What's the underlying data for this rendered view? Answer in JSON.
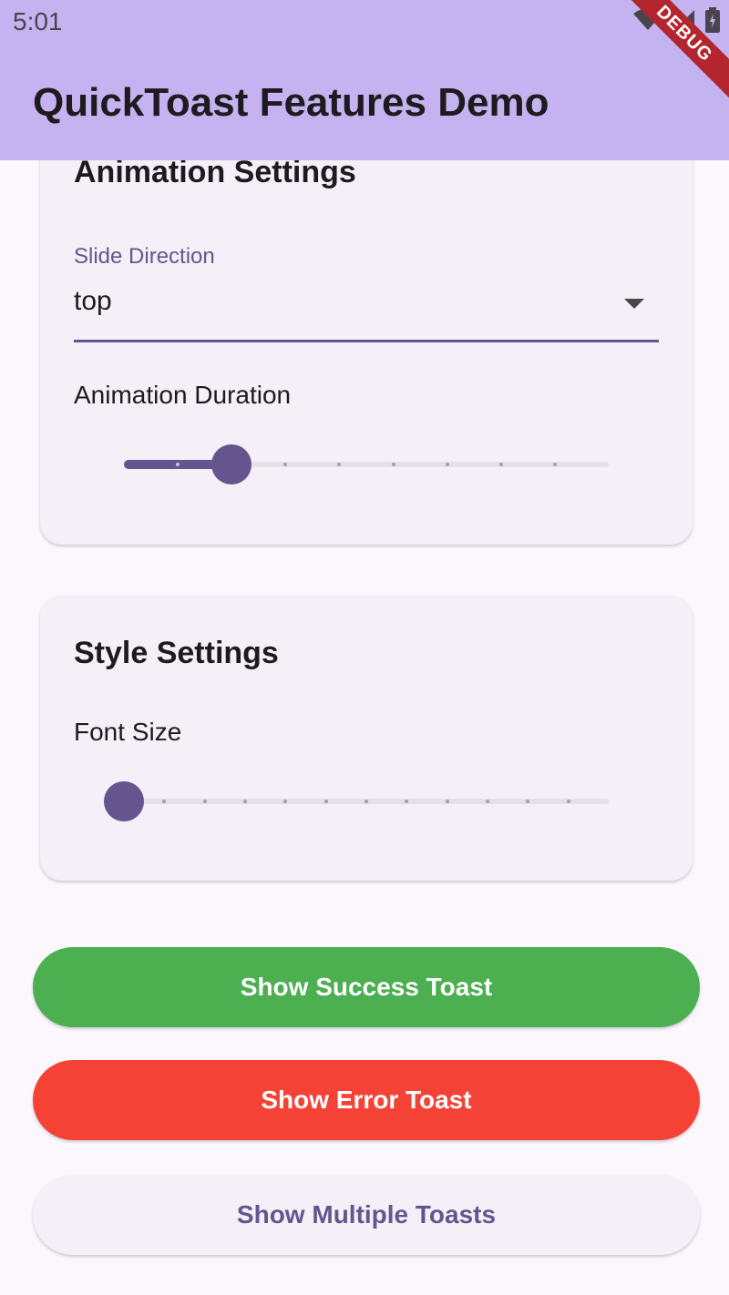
{
  "status_bar": {
    "time": "5:01",
    "icons": [
      "wifi-icon",
      "cell-signal-icon",
      "battery-icon"
    ]
  },
  "app_bar": {
    "title": "QuickToast Features Demo",
    "debug_banner": "DEBUG",
    "color": "#c5b3f1"
  },
  "animation_card": {
    "title": "Animation Settings",
    "slide_direction": {
      "label": "Slide Direction",
      "value": "top"
    },
    "duration_slider": {
      "label": "Animation Duration",
      "divisions": 9,
      "value_fraction": 0.2222
    }
  },
  "style_card": {
    "title": "Style Settings",
    "font_size_slider": {
      "label": "Font Size",
      "divisions": 12,
      "value_fraction": 0
    }
  },
  "buttons": {
    "success": "Show Success Toast",
    "error": "Show Error Toast",
    "multiple": "Show Multiple Toasts"
  },
  "colors": {
    "primary": "#65558f",
    "success": "#4caf50",
    "error": "#f44336",
    "background": "#fcf6fd",
    "card": "#f5eff7"
  }
}
